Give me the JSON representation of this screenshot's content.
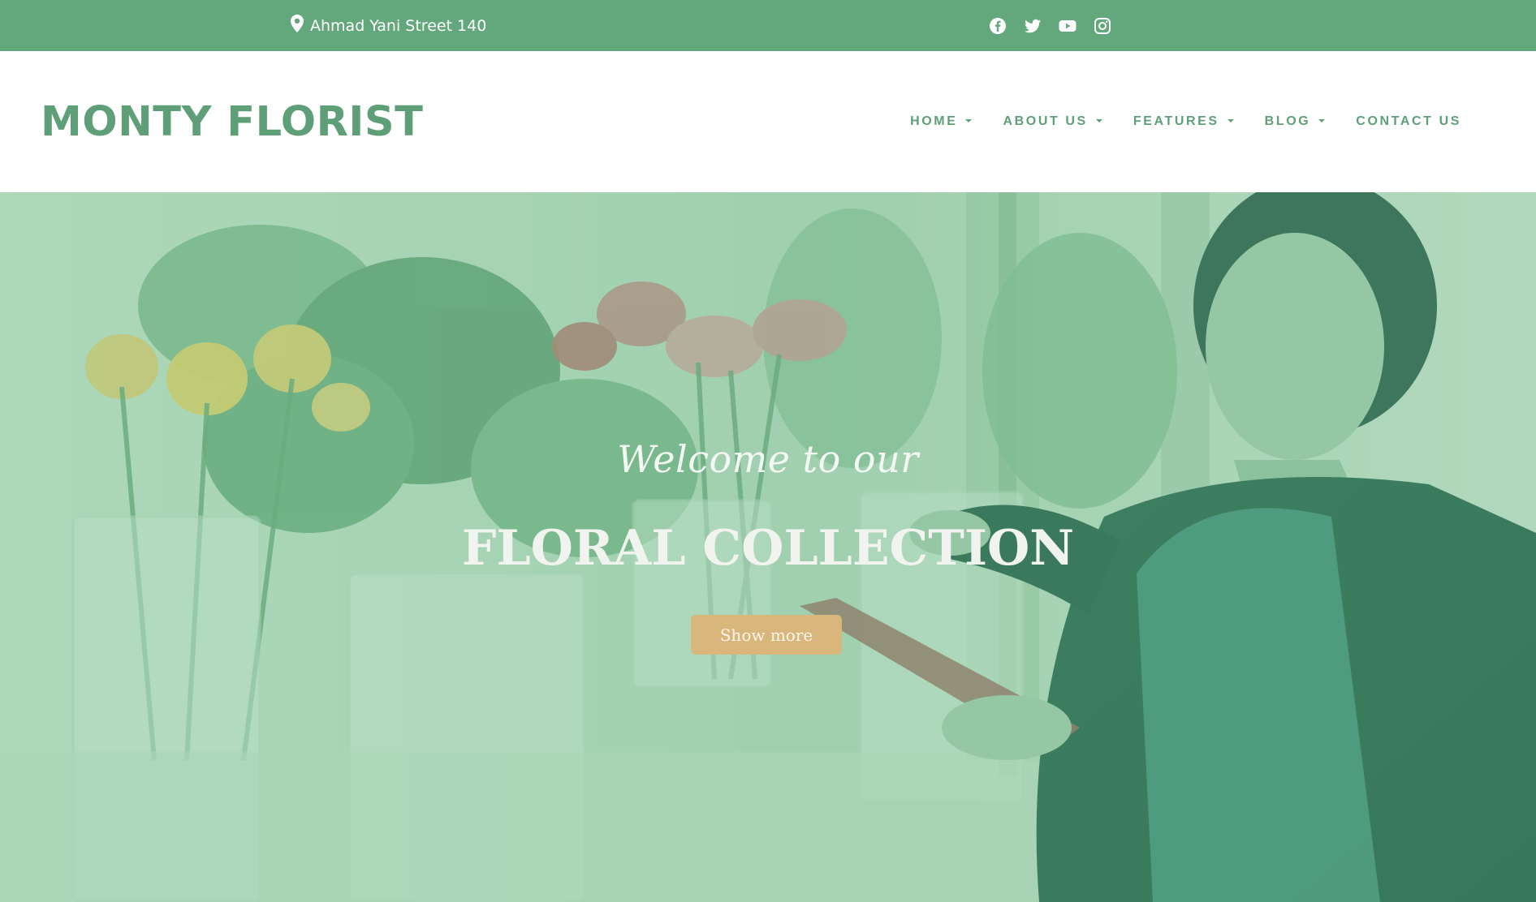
{
  "topbar": {
    "address": "Ahmad Yani Street 140",
    "address_icon": "map-pin-icon",
    "social": [
      "facebook-icon",
      "twitter-icon",
      "youtube-icon",
      "instagram-icon"
    ]
  },
  "header": {
    "logo": "MONTY FLORIST",
    "nav": [
      {
        "label": "HOME",
        "dropdown": true
      },
      {
        "label": "ABOUT US",
        "dropdown": true
      },
      {
        "label": "FEATURES",
        "dropdown": true
      },
      {
        "label": "BLOG",
        "dropdown": true
      },
      {
        "label": "CONTACT US",
        "dropdown": false
      }
    ]
  },
  "hero": {
    "welcome": "Welcome to our",
    "headline": "FLORAL COLLECTION",
    "button": "Show more"
  },
  "colors": {
    "brand_green": "#63a77c",
    "accent_gold": "#d8b67c",
    "white": "#ffffff"
  }
}
